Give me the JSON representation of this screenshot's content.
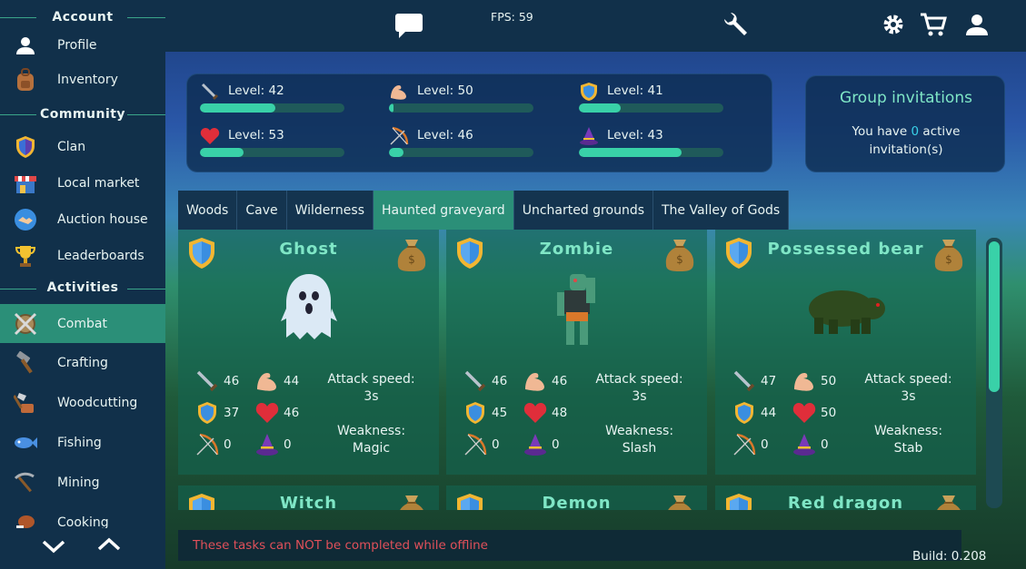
{
  "sidebar": {
    "sections": {
      "account": "Account",
      "community": "Community",
      "activities": "Activities"
    },
    "items": [
      {
        "label": "Profile",
        "icon": "person-icon"
      },
      {
        "label": "Inventory",
        "icon": "backpack-icon"
      },
      {
        "label": "Clan",
        "icon": "clan-shield-icon"
      },
      {
        "label": "Local market",
        "icon": "market-stall-icon"
      },
      {
        "label": "Auction house",
        "icon": "handshake-icon"
      },
      {
        "label": "Leaderboards",
        "icon": "trophy-icon"
      },
      {
        "label": "Combat",
        "icon": "crossed-swords-shield-icon"
      },
      {
        "label": "Crafting",
        "icon": "hammer-icon"
      },
      {
        "label": "Woodcutting",
        "icon": "axe-log-icon"
      },
      {
        "label": "Fishing",
        "icon": "fish-icon"
      },
      {
        "label": "Mining",
        "icon": "pickaxe-icon"
      },
      {
        "label": "Cooking",
        "icon": "meat-icon"
      }
    ],
    "active": "Combat"
  },
  "topbar": {
    "fps": "FPS: 59"
  },
  "stats": [
    {
      "icon": "sword-icon",
      "text": "Level: 42",
      "progress": 0.52
    },
    {
      "icon": "strength-arm-icon",
      "text": "Level: 50",
      "progress": 0.03
    },
    {
      "icon": "defense-shield-icon",
      "text": "Level: 41",
      "progress": 0.29
    },
    {
      "icon": "heart-icon",
      "text": "Level: 53",
      "progress": 0.3
    },
    {
      "icon": "bow-icon",
      "text": "Level: 46",
      "progress": 0.1
    },
    {
      "icon": "wizard-hat-icon",
      "text": "Level: 43",
      "progress": 0.71
    }
  ],
  "group": {
    "title": "Group invitations",
    "text_before": "You have ",
    "count": "0",
    "text_after": " active",
    "text_line2": "invitation(s)"
  },
  "tabs": [
    "Woods",
    "Cave",
    "Wilderness",
    "Haunted graveyard",
    "Uncharted grounds",
    "The Valley of Gods"
  ],
  "active_tab": "Haunted graveyard",
  "monsters": [
    {
      "name": "Ghost",
      "atk": "46",
      "str": "44",
      "def": "37",
      "hp": "46",
      "rng": "0",
      "mag": "0",
      "speed_label": "Attack speed:",
      "speed": "3s",
      "weak_label": "Weakness:",
      "weakness": "Magic"
    },
    {
      "name": "Zombie",
      "atk": "46",
      "str": "46",
      "def": "45",
      "hp": "48",
      "rng": "0",
      "mag": "0",
      "speed_label": "Attack speed:",
      "speed": "3s",
      "weak_label": "Weakness:",
      "weakness": "Slash"
    },
    {
      "name": "Possessed bear",
      "atk": "47",
      "str": "50",
      "def": "44",
      "hp": "50",
      "rng": "0",
      "mag": "0",
      "speed_label": "Attack speed:",
      "speed": "3s",
      "weak_label": "Weakness:",
      "weakness": "Stab"
    }
  ],
  "monsters_row2": [
    "Witch",
    "Demon",
    "Red dragon"
  ],
  "footer": {
    "warning": "These tasks can NOT be completed while offline",
    "build": "Build: 0.208"
  },
  "colors": {
    "accent": "#2b8f78",
    "bar_fill": "#39d1a8",
    "sidebar": "#11304a",
    "warning": "#e0505a"
  }
}
